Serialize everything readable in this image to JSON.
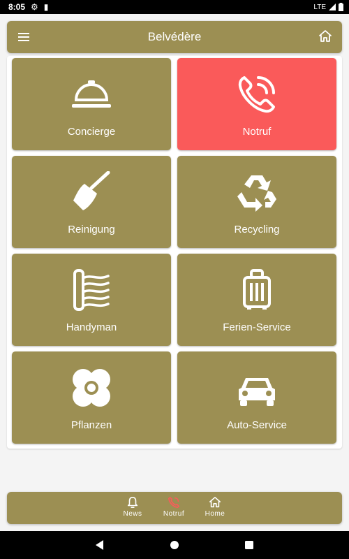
{
  "status_bar": {
    "time": "8:05",
    "network": "LTE"
  },
  "app_bar": {
    "title": "Belvédère",
    "menu_icon": "menu-icon",
    "home_icon": "home-icon"
  },
  "tiles": [
    {
      "label": "Concierge",
      "icon": "service-bell-icon",
      "color": "#9c8f53"
    },
    {
      "label": "Notruf",
      "icon": "phone-ringing-icon",
      "color": "#fa5a5a"
    },
    {
      "label": "Reinigung",
      "icon": "broom-icon",
      "color": "#9c8f53"
    },
    {
      "label": "Recycling",
      "icon": "recycle-icon",
      "color": "#9c8f53"
    },
    {
      "label": "Handyman",
      "icon": "radiator-icon",
      "color": "#9c8f53"
    },
    {
      "label": "Ferien-Service",
      "icon": "suitcase-icon",
      "color": "#9c8f53"
    },
    {
      "label": "Pflanzen",
      "icon": "flower-icon",
      "color": "#9c8f53"
    },
    {
      "label": "Auto-Service",
      "icon": "car-icon",
      "color": "#9c8f53"
    }
  ],
  "bottom_nav": [
    {
      "label": "News",
      "icon": "bell-icon"
    },
    {
      "label": "Notruf",
      "icon": "phone-icon",
      "icon_color": "#fa5a5a"
    },
    {
      "label": "Home",
      "icon": "home-icon"
    }
  ],
  "colors": {
    "accent": "#9c8f53",
    "emergency": "#fa5a5a"
  }
}
